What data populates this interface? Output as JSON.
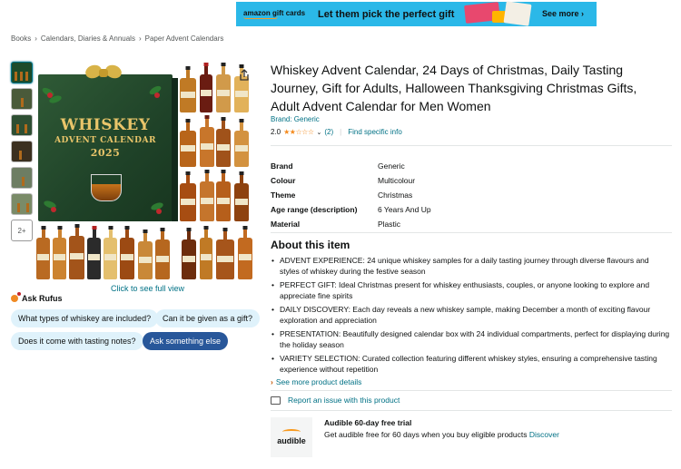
{
  "banner": {
    "brand_line1": "amazon",
    "brand_line2": "gift cards",
    "slogan": "Let them pick the perfect gift",
    "more": "See more ›",
    "color": "#2bb8e8"
  },
  "breadcrumb": [
    "Books",
    "Calendars, Diaries & Annuals",
    "Paper Advent Calendars"
  ],
  "gallery": {
    "more_label": "2+",
    "caption": "Click to see full view",
    "box_title": "WHISKEY",
    "box_subtitle": "ADVENT CALENDAR",
    "box_year": "2025"
  },
  "rufus": {
    "title": "Ask Rufus",
    "chips": [
      "What types of whiskey are included?",
      "Can it be given as a gift?",
      "Does it come with tasting notes?",
      "Ask something else"
    ]
  },
  "product": {
    "title": "Whiskey Advent Calendar, 24 Days of Christmas, Daily Tasting Journey, Gift for Adults, Halloween Thanksgiving Christmas Gifts, Adult Advent Calendar for Men Women",
    "brand_link": "Brand: Generic",
    "rating": "2.0",
    "stars": "★★☆☆☆",
    "rating_count": "(2)",
    "find_info": "Find specific info",
    "specs": [
      {
        "k": "Brand",
        "v": "Generic"
      },
      {
        "k": "Colour",
        "v": "Multicolour"
      },
      {
        "k": "Theme",
        "v": "Christmas"
      },
      {
        "k": "Age range (description)",
        "v": "6 Years And Up"
      },
      {
        "k": "Material",
        "v": "Plastic"
      }
    ],
    "about_title": "About this item",
    "bullets": [
      "ADVENT EXPERIENCE: 24 unique whiskey samples for a daily tasting journey through diverse flavours and styles of whiskey during the festive season",
      "PERFECT GIFT: Ideal Christmas present for whiskey enthusiasts, couples, or anyone looking to explore and appreciate fine spirits",
      "DAILY DISCOVERY: Each day reveals a new whiskey sample, making December a month of exciting flavour exploration and appreciation",
      "PRESENTATION: Beautifully designed calendar box with 24 individual compartments, perfect for displaying during the holiday season",
      "VARIETY SELECTION: Curated collection featuring different whiskey styles, ensuring a comprehensive tasting experience without repetition"
    ],
    "see_more": "See more product details",
    "report": "Report an issue with this product"
  },
  "audible": {
    "logo": "audible",
    "heading": "Audible 60-day free trial",
    "text": "Get audible free for 60 days when you buy eligible products",
    "link": "Discover"
  }
}
